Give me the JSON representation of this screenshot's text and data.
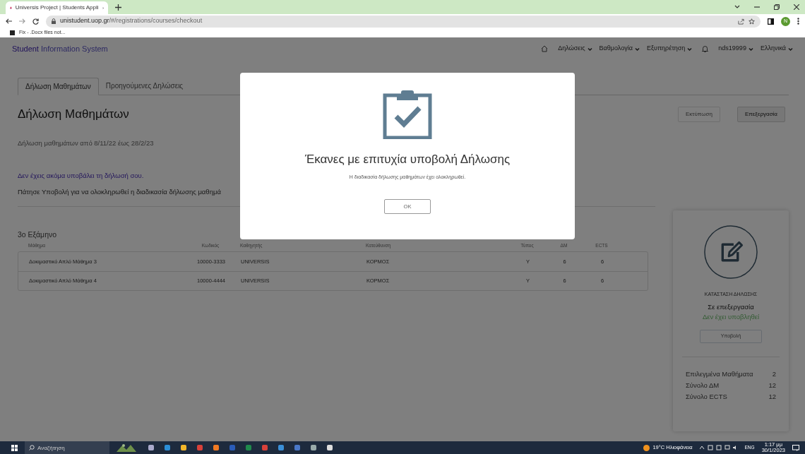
{
  "browser": {
    "tab_title": "Universis Project | Students Appli",
    "url_host": "unistudent.uop.gr",
    "url_path": "/#/registrations/courses/checkout",
    "bookmark": "Fix - .Docx files not...",
    "profile_initial": "N"
  },
  "navbar": {
    "brand_strong": "Student",
    "brand_rest": "Information System",
    "menus": [
      {
        "label": "Δηλώσεις"
      },
      {
        "label": "Βαθμολογία"
      },
      {
        "label": "Εξυπηρέτηση"
      }
    ],
    "user": "nds19999",
    "language": "Ελληνικά"
  },
  "tabs": [
    {
      "label": "Δήλωση Μαθημάτων",
      "selected": true
    },
    {
      "label": "Προηγούμενες Δηλώσεις",
      "selected": false
    }
  ],
  "heading": "Δήλωση Μαθημάτων",
  "actions": [
    {
      "label": "Εκτύπωση",
      "disabled": true
    },
    {
      "label": "Επεξεργασία",
      "disabled": false
    }
  ],
  "period": "Δήλωση μαθημάτων από 8/11/22 έως 28/2/23",
  "warning": "Δεν έχεις ακόμα υποβάλει τη δήλωσή σου.",
  "instruction": "Πάτησε Υποβολή για να ολοκληρωθεί η διαδικασία δήλωσης μαθημά",
  "semester": "3ο Εξάμηνο",
  "table": {
    "columns": [
      "Μάθημα",
      "Κωδικός",
      "Καθηγητής",
      "Κατεύθυνση",
      "Τύπος",
      "ΔΜ",
      "ECTS"
    ],
    "rows": [
      [
        "Δοκιμαστικό Απλό Μάθημα 3",
        "10000-3333",
        "UNIVERSIS",
        "ΚΟΡΜΟΣ",
        "Y",
        "6",
        "6"
      ],
      [
        "Δοκιμαστικό Απλό Μάθημα 4",
        "10000-4444",
        "UNIVERSIS",
        "ΚΟΡΜΟΣ",
        "Y",
        "6",
        "6"
      ]
    ]
  },
  "status_card": {
    "title": "ΚΑΤΑΣΤΑΣΗ ΔΗΛΩΣΗΣ",
    "state": "Σε επεξεργασία",
    "substate": "Δεν έχει υποβληθεί",
    "submit": {
      "label": "Υποβολή",
      "disabled": true
    },
    "summary": [
      {
        "label": "Επιλεγμένα Μαθήματα",
        "value": "2"
      },
      {
        "label": "Σύνολο ΔΜ",
        "value": "12"
      },
      {
        "label": "Σύνολο ECTS",
        "value": "12"
      }
    ]
  },
  "modal": {
    "title": "Έκανες με επιτυχία υποβολή Δήλωσης",
    "message": "Η διαδικασία δήλωσης μαθημάτων έχει ολοκληρωθεί.",
    "button": "OK"
  },
  "taskbar": {
    "search_placeholder": "Αναζήτηση",
    "weather": "19°C Ηλιοφάνεια",
    "language": "ENG",
    "time": "1:17 μμ",
    "date": "30/1/2023"
  }
}
